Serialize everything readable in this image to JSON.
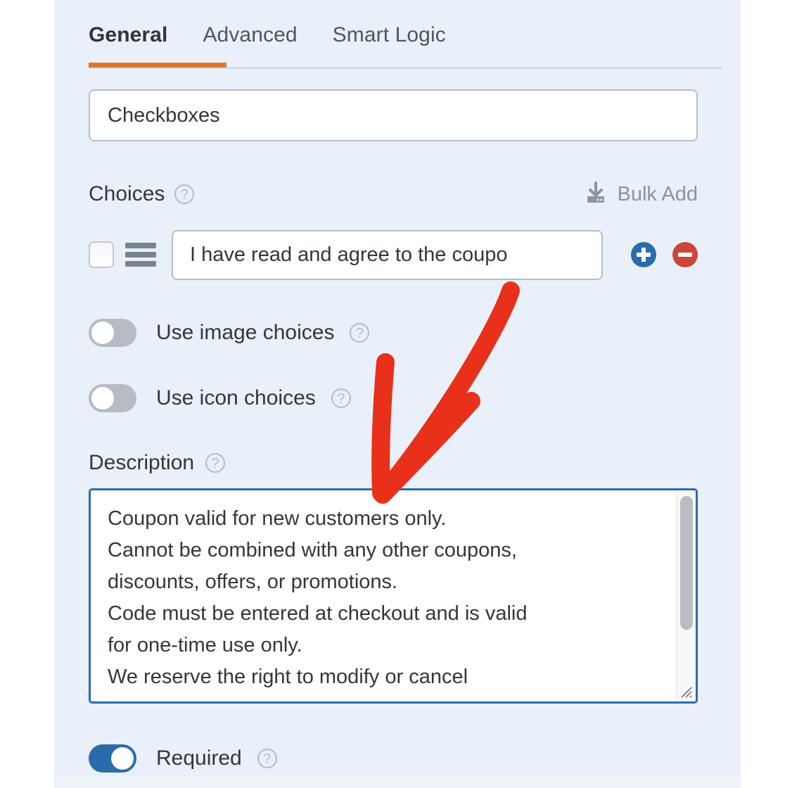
{
  "panel": {
    "background_color": "#e9f0f9"
  },
  "tabs": {
    "items": [
      {
        "label": "General",
        "active": true
      },
      {
        "label": "Advanced",
        "active": false
      },
      {
        "label": "Smart Logic",
        "active": false
      }
    ],
    "active_underline_color": "#da7730"
  },
  "field_label": {
    "value": "Checkboxes",
    "placeholder": "Label"
  },
  "choices": {
    "label": "Choices",
    "help_icon": "question-mark-icon",
    "help_glyph": "?",
    "bulk_add": {
      "label": "Bulk Add",
      "icon": "bulk-add-download-icon"
    },
    "rows": [
      {
        "checkbox_checked": false,
        "drag_handle_icon": "drag-handle-icon",
        "value": "I have read and agree to the coupo",
        "add_icon": "plus-circle-icon",
        "remove_icon": "minus-circle-icon",
        "add_color": "#2a6cab",
        "remove_color": "#cc4536"
      }
    ]
  },
  "toggles": {
    "use_image_choices": {
      "label": "Use image choices",
      "state": "off",
      "help_glyph": "?"
    },
    "use_icon_choices": {
      "label": "Use icon choices",
      "state": "off",
      "help_glyph": "?"
    },
    "required": {
      "label": "Required",
      "state": "on",
      "help_glyph": "?",
      "on_color": "#2a6cab"
    }
  },
  "description": {
    "label": "Description",
    "help_glyph": "?",
    "focused": true,
    "focus_border_color": "#2b6cb0",
    "value": "Coupon valid for new customers only.\nCannot be combined with any other coupons,\ndiscounts, offers, or promotions.\nCode must be entered at checkout and is valid\nfor one-time use only.\nWe reserve the right to modify or cancel",
    "scrollbar": {
      "visible": true,
      "thumb_color": "#b9bcc0"
    },
    "resize_handle_icon": "resize-grip-icon"
  },
  "annotation": {
    "type": "arrow",
    "color": "#e8301b",
    "points_to": "description-textarea",
    "direction": "down-left"
  }
}
